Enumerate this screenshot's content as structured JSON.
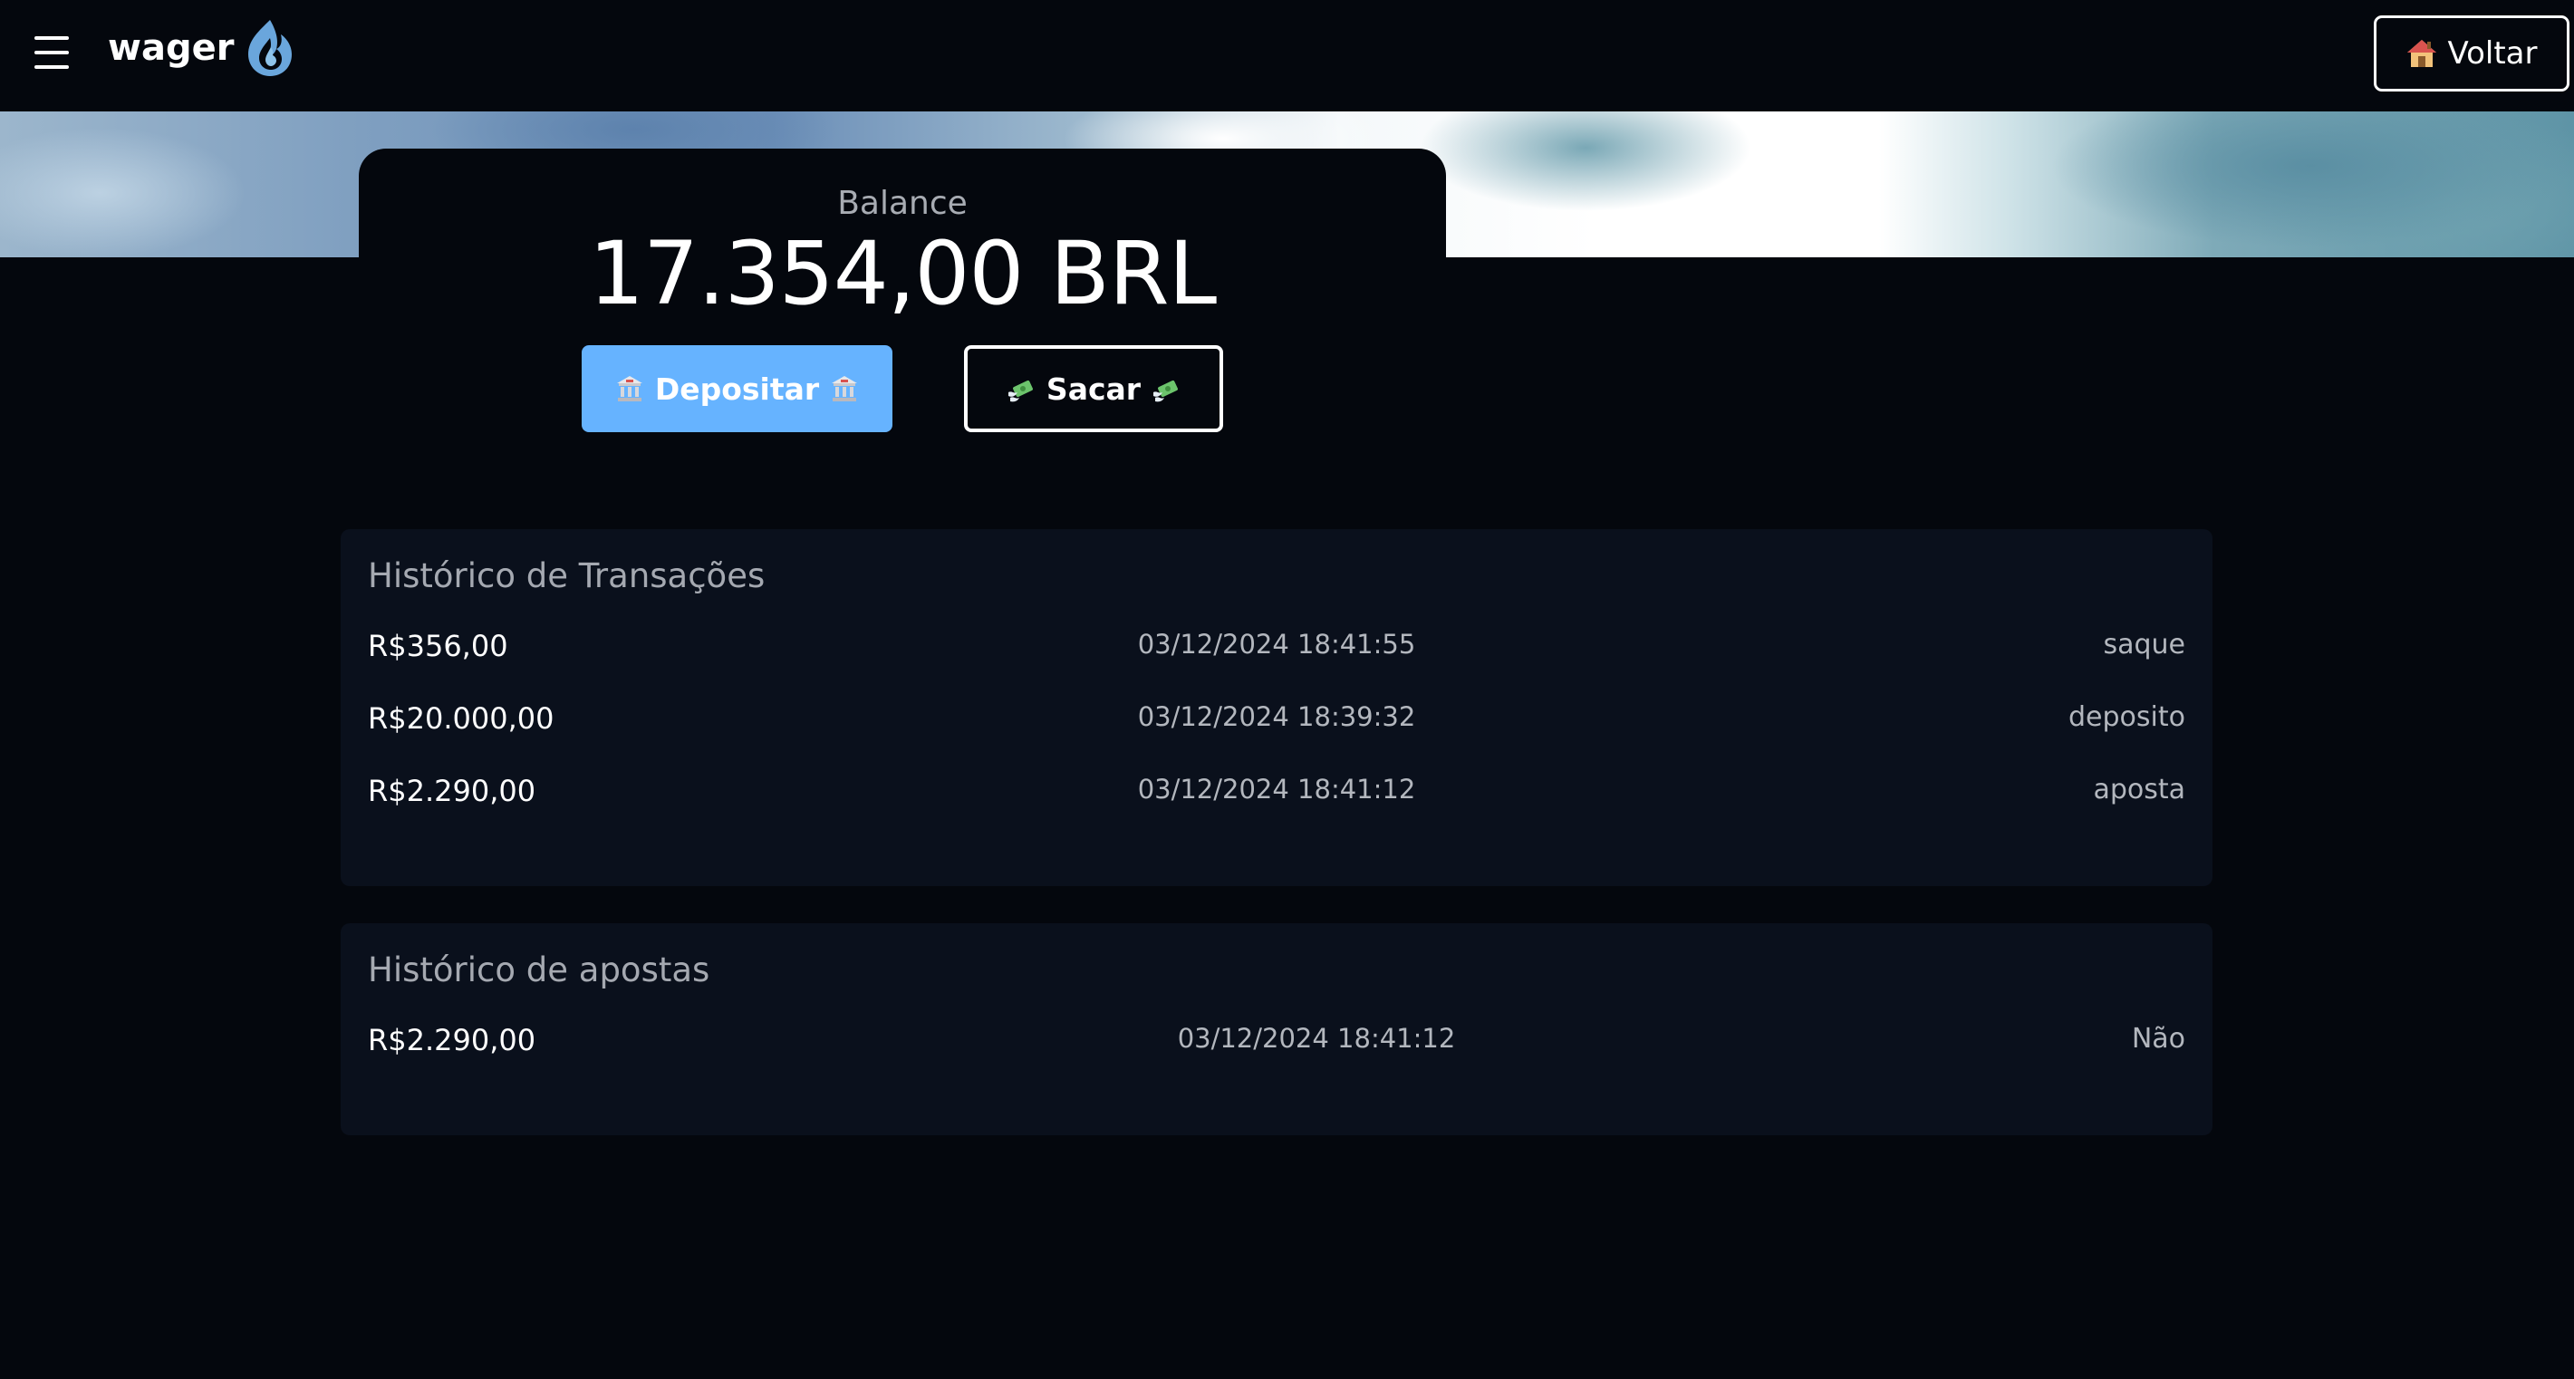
{
  "header": {
    "logo_text": "wager",
    "back_button_label": "Voltar",
    "back_button_icon": "house-icon"
  },
  "balance": {
    "label": "Balance",
    "value": "17.354,00 BRL",
    "deposit_label": "Depositar",
    "withdraw_label": "Sacar",
    "deposit_icon": "bank-icon",
    "withdraw_icon": "money-with-wings-icon"
  },
  "transactions": {
    "title": "Histórico de Transações",
    "rows": [
      {
        "amount": "R$356,00",
        "date": "03/12/2024 18:41:55",
        "type": "saque"
      },
      {
        "amount": "R$20.000,00",
        "date": "03/12/2024 18:39:32",
        "type": "deposito"
      },
      {
        "amount": "R$2.290,00",
        "date": "03/12/2024 18:41:12",
        "type": "aposta"
      }
    ]
  },
  "bets": {
    "title": "Histórico de apostas",
    "rows": [
      {
        "amount": "R$2.290,00",
        "date": "03/12/2024 18:41:12",
        "result": "Não"
      }
    ]
  },
  "colors": {
    "background": "#04070d",
    "panel": "#0a101c",
    "deposit_button": "#66b3ff",
    "muted_text": "#a5a9b1"
  }
}
